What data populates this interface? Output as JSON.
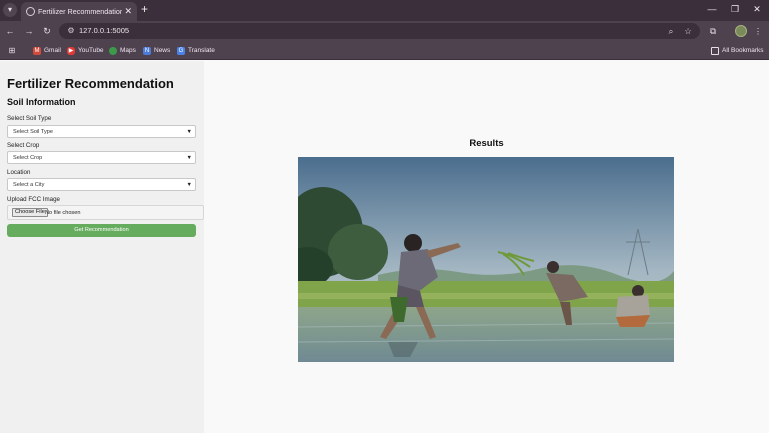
{
  "browser": {
    "tab_title": "Fertilizer Recommendation Sys",
    "url": "127.0.0.1:5005",
    "bookmarks": [
      "Gmail",
      "YouTube",
      "Maps",
      "News",
      "Translate"
    ],
    "all_bookmarks": "All Bookmarks"
  },
  "sidebar": {
    "title": "Fertilizer Recommendation",
    "section": "Soil Information",
    "soil_label": "Select Soil Type",
    "soil_value": "Select Soil Type",
    "crop_label": "Select Crop",
    "crop_value": "Select Crop",
    "location_label": "Location",
    "location_value": "Select a City",
    "upload_label": "Upload FCC Image",
    "file_button": "Choose File",
    "file_status": "No file chosen",
    "submit_label": "Get Recommendation"
  },
  "main": {
    "results_title": "Results"
  },
  "colors": {
    "accent_button": "#66ac5f",
    "browser_frame": "#4f424f"
  }
}
